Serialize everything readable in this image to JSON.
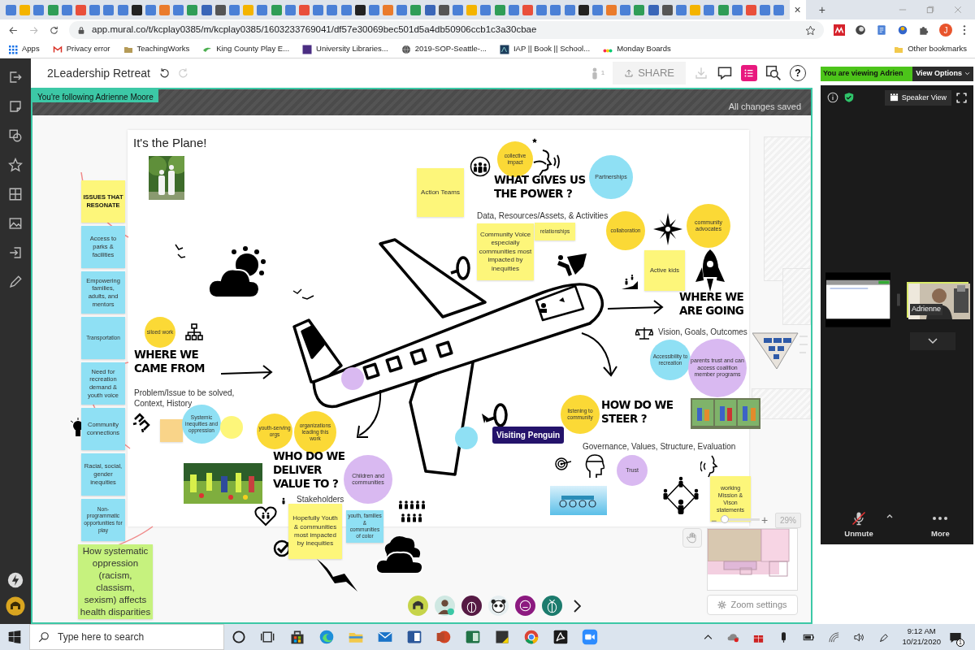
{
  "browser": {
    "tab_close": "×",
    "new_tab": "+",
    "address": "app.mural.co/t/kcplay0385/m/kcplay0385/1603233769041/df57e30069bec501d5a4db50906ccb1c3a30cbae",
    "profile_initial": "J",
    "bookmarks": [
      {
        "label": "Apps"
      },
      {
        "label": "Privacy error"
      },
      {
        "label": "TeachingWorks"
      },
      {
        "label": "King County Play E..."
      },
      {
        "label": "University Libraries..."
      },
      {
        "label": "2019-SOP-Seattle-..."
      },
      {
        "label": "IAP || Book || School..."
      },
      {
        "label": "Monday Boards"
      }
    ],
    "other_bookmarks": "Other bookmarks"
  },
  "mural": {
    "title": "2Leadership Retreat",
    "online_count": "1",
    "share": {
      "label": "SHARE",
      "disabled": true
    },
    "help": "?",
    "following": "You're following Adrienne Moore",
    "save_status": "All changes saved",
    "board": {
      "title": "It's the Plane!",
      "items": [
        {
          "kind": "sticky",
          "text": "ISSUES THAT RESONATE",
          "color": "#fdf67a",
          "bold": true
        },
        {
          "kind": "sticky",
          "text": "Access to parks & facilities",
          "color": "#8fe0f4"
        },
        {
          "kind": "sticky",
          "text": "Empowering families, adults, and mentors",
          "color": "#8fe0f4"
        },
        {
          "kind": "sticky",
          "text": "Transportation",
          "color": "#8fe0f4"
        },
        {
          "kind": "sticky",
          "text": "Need for recreation demand & youth voice",
          "color": "#8fe0f4"
        },
        {
          "kind": "sticky",
          "text": "Community connections",
          "color": "#8fe0f4"
        },
        {
          "kind": "sticky",
          "text": "Racial, social, gender inequities",
          "color": "#8fe0f4"
        },
        {
          "kind": "sticky",
          "text": "Non-programmatic opportunities for play",
          "color": "#8fe0f4"
        },
        {
          "kind": "sticky",
          "text": "How systematic oppression (racism, classism, sexism) affects health disparities",
          "color": "#c6f27e"
        },
        {
          "kind": "sticky",
          "text": "Action Teams",
          "color": "#fdf67a"
        },
        {
          "kind": "sticky",
          "text": "Community Voice especially communities most impacted by inequities",
          "color": "#fdf67a"
        },
        {
          "kind": "sticky",
          "text": "relationships",
          "color": "#fdf67a"
        },
        {
          "kind": "sticky",
          "text": "Active kids",
          "color": "#fdf67a"
        },
        {
          "kind": "sticky",
          "color": "#f9d489"
        },
        {
          "kind": "sticky",
          "text": "Hopefully Youth & communities most impacted by inequities",
          "color": "#fdf67a"
        },
        {
          "kind": "sticky",
          "text": "youth, families & communities of color",
          "color": "#8fe0f4"
        },
        {
          "kind": "sticky",
          "text": "working Mission & Vison statements",
          "color": "#fdf67a"
        },
        {
          "kind": "circle",
          "text": "siloed work",
          "color": "#fbd936"
        },
        {
          "kind": "circle",
          "text": "collective impact",
          "color": "#fbd936"
        },
        {
          "kind": "circle",
          "text": "Partnerships",
          "color": "#8fe0f4"
        },
        {
          "kind": "circle",
          "text": "collaboration",
          "color": "#fbd936"
        },
        {
          "kind": "circle",
          "text": "community advocates",
          "color": "#fbd936"
        },
        {
          "kind": "circle",
          "text": "Accessibility to recreation",
          "color": "#8fe0f4"
        },
        {
          "kind": "circle",
          "text": "parents trust and can access coalition member programs",
          "color": "#d9b9f1"
        },
        {
          "kind": "circle",
          "text": "Systemic inequities and oppression",
          "color": "#8fe0f4"
        },
        {
          "kind": "circle",
          "color": "#fdf67a"
        },
        {
          "kind": "circle",
          "text": "youth-serving orgs",
          "color": "#fbd936"
        },
        {
          "kind": "circle",
          "text": "organizations leading this work",
          "color": "#fbd936"
        },
        {
          "kind": "circle",
          "text": "Children and communities",
          "color": "#d9b9f1"
        },
        {
          "kind": "circle",
          "text": "listening to community",
          "color": "#fbd936"
        },
        {
          "kind": "circle",
          "text": "Trust",
          "color": "#d9b9f1"
        },
        {
          "kind": "circle",
          "color": "#d9b9f1"
        },
        {
          "kind": "circle",
          "color": "#8fe0f4"
        },
        {
          "kind": "heading",
          "text": "WHERE WE\nCAME FROM"
        },
        {
          "kind": "heading",
          "text": "WHAT GIVES US\nTHE POWER ?"
        },
        {
          "kind": "heading",
          "text": "WHERE WE\nARE GOING"
        },
        {
          "kind": "heading",
          "text": "HOW DO WE\nSTEER ?"
        },
        {
          "kind": "heading",
          "text": "WHO DO WE\nDELIVER\nVALUE TO ?"
        },
        {
          "kind": "caption",
          "text": "Data, Resources/Assets, & Activities"
        },
        {
          "kind": "caption",
          "text": "Problem/Issue to be solved, Context, History"
        },
        {
          "kind": "caption",
          "text": "Vision, Goals, Outcomes"
        },
        {
          "kind": "caption",
          "text": "Governance, Values, Structure, Evaluation"
        },
        {
          "kind": "caption",
          "text": "Stakeholders"
        }
      ]
    },
    "cursor_label": "Visiting Penguin",
    "zoom": {
      "minus": "−",
      "plus": "+",
      "level": 0.1,
      "percent": "29%",
      "settings": "Zoom settings"
    }
  },
  "meeting": {
    "banner": "You are viewing Adrien",
    "view_options": "View Options",
    "speaker_view": "Speaker View",
    "participant": "Adrienne",
    "muted": true,
    "unmute": "Unmute",
    "more": "More"
  },
  "taskbar": {
    "search_placeholder": "Type here to search",
    "time": "9:12 AM",
    "date": "10/21/2020",
    "notifications": "1"
  }
}
